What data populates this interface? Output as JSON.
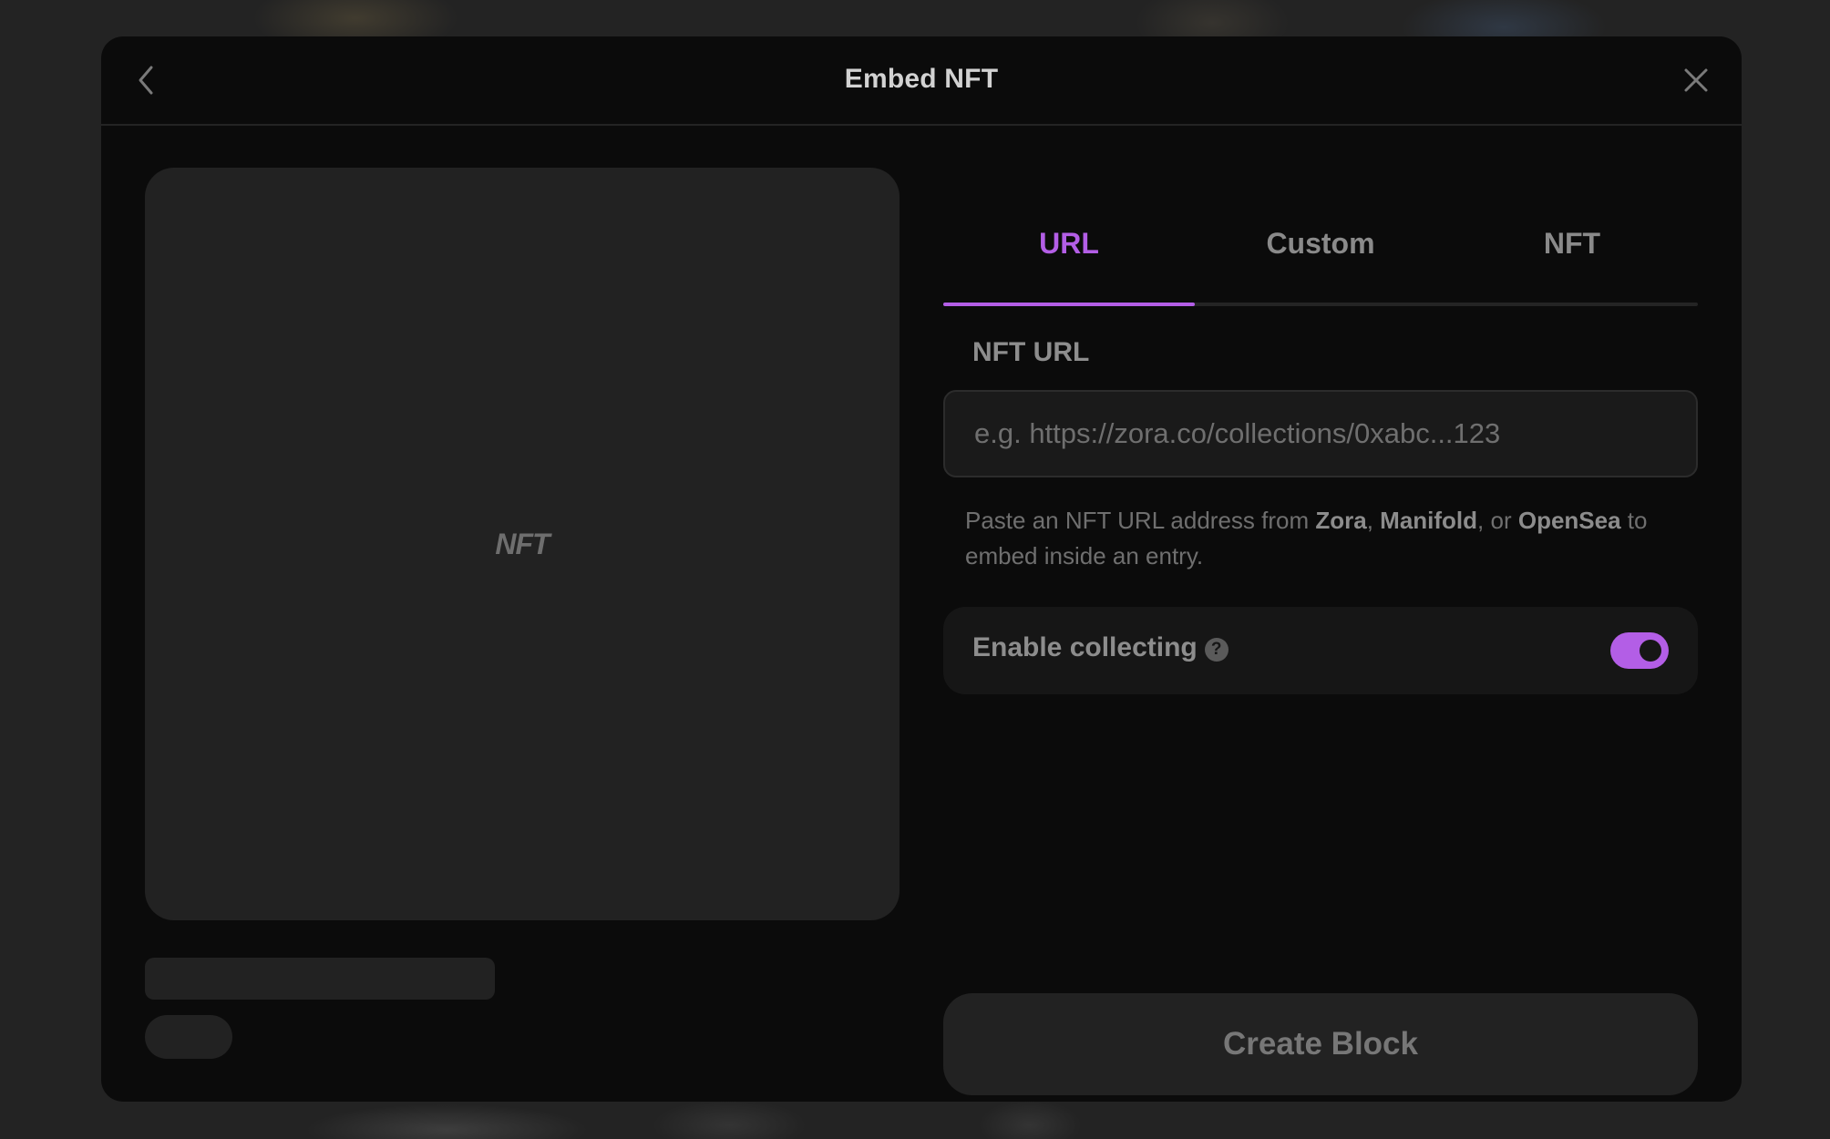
{
  "modal": {
    "title": "Embed NFT",
    "back_icon": "chevron-left-icon",
    "close_icon": "close-icon"
  },
  "preview": {
    "placeholder_mark": "NFT"
  },
  "tabs": [
    {
      "label": "URL",
      "active": true
    },
    {
      "label": "Custom",
      "active": false
    },
    {
      "label": "NFT",
      "active": false
    }
  ],
  "url_field": {
    "label": "NFT URL",
    "value": "",
    "placeholder": "e.g. https://zora.co/collections/0xabc...123"
  },
  "help": {
    "prefix": "Paste an NFT URL address from ",
    "platforms": [
      "Zora",
      "Manifold",
      "OpenSea"
    ],
    "sep1": ", ",
    "sep2": ", or ",
    "suffix": " to embed inside an entry."
  },
  "collecting": {
    "label": "Enable collecting",
    "help_icon": "?",
    "enabled": true
  },
  "create_button": {
    "label": "Create Block"
  },
  "colors": {
    "accent": "#b35ee6",
    "modal_bg": "#0b0b0b",
    "surface": "#222222"
  }
}
